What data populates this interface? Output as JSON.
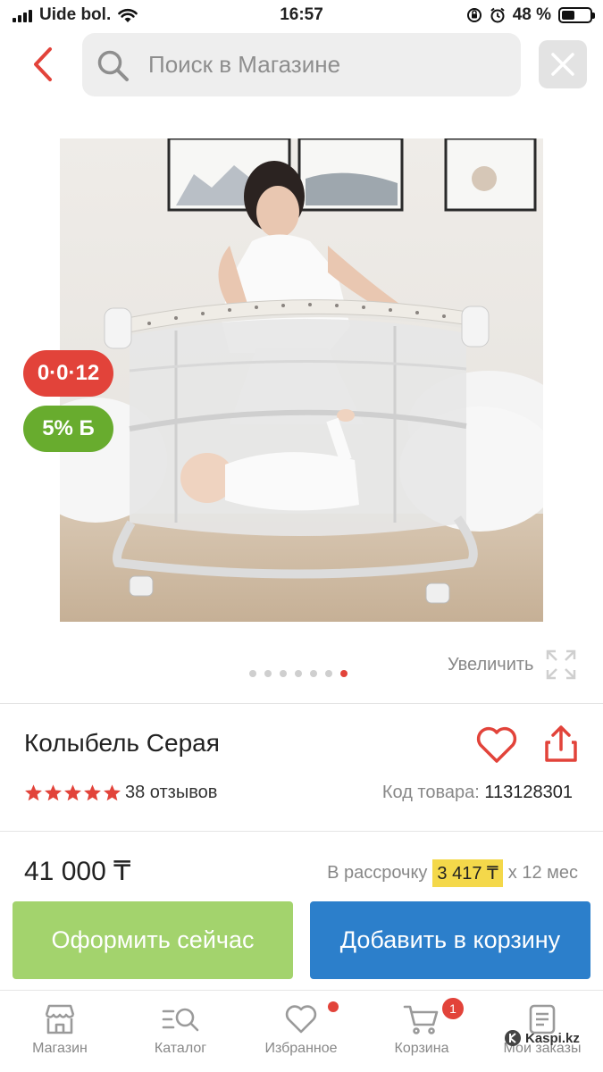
{
  "status_bar": {
    "carrier": "Uide bol.",
    "time": "16:57",
    "battery": "48 %",
    "battery_level": 0.48
  },
  "header": {
    "search_placeholder": "Поиск в Магазине",
    "back_icon": "chevron-left-icon",
    "close_icon": "close-icon"
  },
  "gallery": {
    "badges": {
      "installment": "0·0·12",
      "bonus": "5% Б"
    },
    "zoom_label": "Увеличить",
    "image_count": 7,
    "active_index": 6
  },
  "product": {
    "title": "Колыбель Серая",
    "rating": 5,
    "reviews": "38 отзывов",
    "code_label": "Код товара:",
    "code_value": "113128301",
    "price": "41 000 ₸",
    "installment_label": "В рассрочку",
    "installment_amount": "3 417 ₸",
    "installment_term": "х 12 мес"
  },
  "actions": {
    "buy_now": "Оформить сейчас",
    "add_to_cart": "Добавить в корзину"
  },
  "nav": {
    "items": [
      {
        "label": "Магазин",
        "icon": "store-icon"
      },
      {
        "label": "Каталог",
        "icon": "catalog-icon"
      },
      {
        "label": "Избранное",
        "icon": "heart-icon"
      },
      {
        "label": "Корзина",
        "icon": "cart-icon"
      },
      {
        "label": "Мои заказы",
        "icon": "orders-icon"
      }
    ],
    "cart_count": "1",
    "watermark": "Kaspi.kz"
  },
  "colors": {
    "accent_red": "#e2433a",
    "bonus_green": "#68ac2e",
    "buy_green": "#a3d36d",
    "cart_blue": "#2c7fcb",
    "installment_yellow": "#f4d84a"
  }
}
